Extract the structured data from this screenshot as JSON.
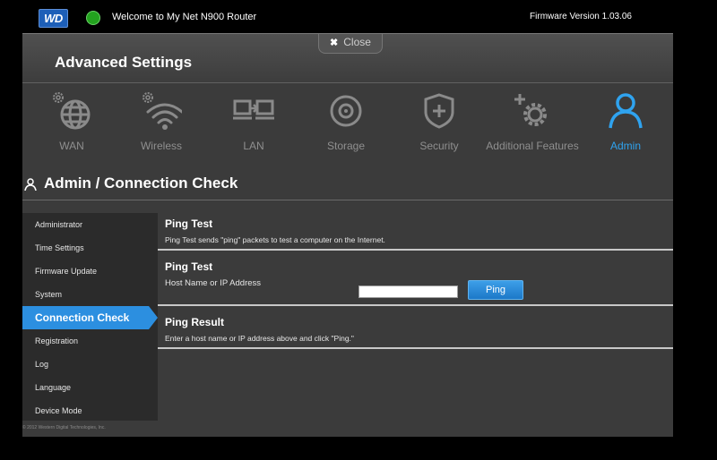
{
  "topbar": {
    "logo_text": "WD",
    "welcome": "Welcome to My Net N900 Router",
    "firmware": "Firmware Version 1.03.06"
  },
  "header": {
    "title": "Advanced Settings",
    "close_label": "Close",
    "close_glyph": "✖"
  },
  "nav": {
    "wan": "WAN",
    "wireless": "Wireless",
    "lan": "LAN",
    "storage": "Storage",
    "security": "Security",
    "additional": "Additional Features",
    "admin": "Admin",
    "active": "Admin",
    "active_color": "#2fa3ef",
    "inactive_color": "#8f8f8f"
  },
  "page": {
    "title": "Admin / Connection Check"
  },
  "sidebar": {
    "items": [
      "Administrator",
      "Time Settings",
      "Firmware Update",
      "System",
      "Connection Check",
      "Registration",
      "Log",
      "Language",
      "Device Mode"
    ],
    "active": "Connection Check",
    "active_color": "#2c8fe0"
  },
  "ping_test_info": {
    "heading": "Ping Test",
    "description": "Ping Test sends \"ping\" packets to test a computer on the Internet."
  },
  "ping_test_form": {
    "heading": "Ping Test",
    "host_label": "Host Name or IP Address",
    "host_value": "",
    "ping_button": "Ping"
  },
  "ping_result": {
    "heading": "Ping Result",
    "message": "Enter a host name or IP address above and click \"Ping.\""
  },
  "footer": {
    "copyright": "© 2012 Western Digital Technologies, Inc."
  }
}
